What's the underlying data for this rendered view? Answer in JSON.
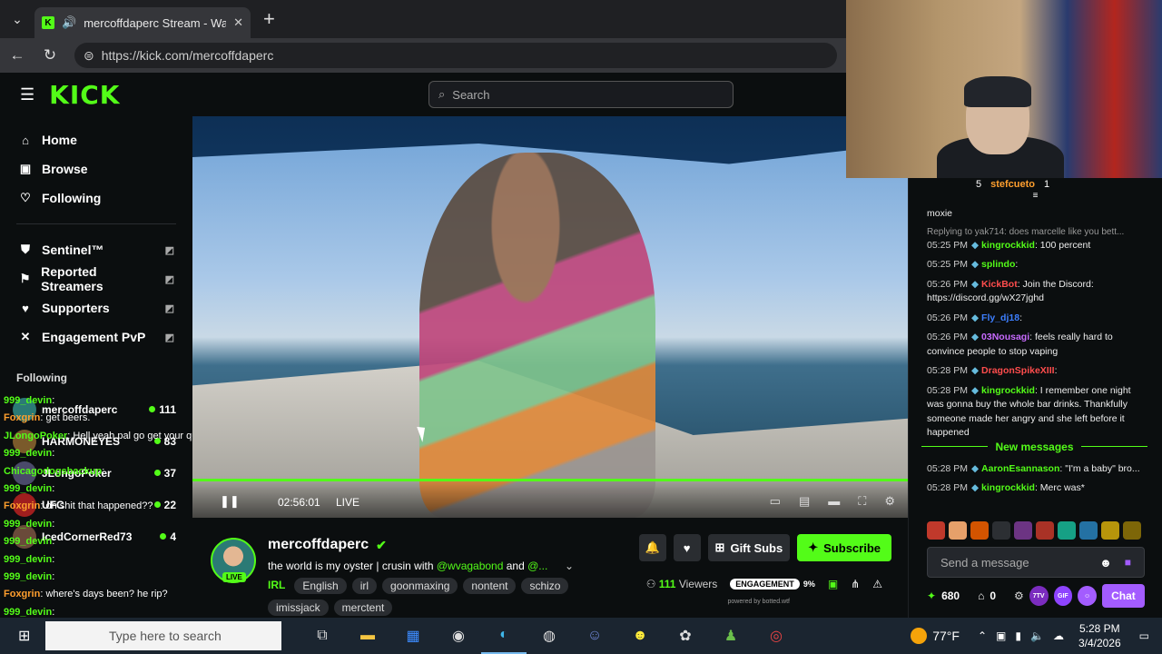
{
  "browser": {
    "tab_title": "mercoffdaperc Stream - Watch",
    "url": "https://kick.com/mercoffdaperc",
    "new_tab": "+",
    "tab_close": "✕"
  },
  "header": {
    "logo": "KICK",
    "search_placeholder": "Search"
  },
  "sidebar": {
    "nav": [
      {
        "label": "Home",
        "icon": "home-icon"
      },
      {
        "label": "Browse",
        "icon": "browse-icon"
      },
      {
        "label": "Following",
        "icon": "heart-icon"
      }
    ],
    "extensions": [
      {
        "label": "Sentinel™"
      },
      {
        "label": "Reported Streamers"
      },
      {
        "label": "Supporters"
      },
      {
        "label": "Engagement PvP"
      }
    ],
    "following_heading": "Following",
    "following": [
      {
        "name": "mercoffdaperc",
        "count": "111"
      },
      {
        "name": "HARMONEYES",
        "count": "83"
      },
      {
        "name": "JLongoPoker",
        "count": "37"
      },
      {
        "name": "UFC",
        "count": "22"
      },
      {
        "name": "IcedCornerRed73",
        "count": "4"
      }
    ]
  },
  "overlay_chat": [
    {
      "user": "999_devin",
      "text": ":"
    },
    {
      "user": "Foxgrin",
      "text": ": get beers."
    },
    {
      "user": "JLongoPoker",
      "text": ": Hell yeah pal go get your queers"
    },
    {
      "user": "999_devin",
      "text": ":"
    },
    {
      "user": "Chicagodogsbackup",
      "text": ":"
    },
    {
      "user": "999_devin",
      "text": ":"
    },
    {
      "user": "Foxgrin",
      "text": ": oh shit that happened??"
    },
    {
      "user": "999_devin",
      "text": ":"
    },
    {
      "user": "999_devin",
      "text": ":"
    },
    {
      "user": "999_devin",
      "text": ":"
    },
    {
      "user": "999_devin",
      "text": ":"
    },
    {
      "user": "Foxgrin",
      "text": ": where's days been? he rip?"
    },
    {
      "user": "999_devin",
      "text": ":"
    }
  ],
  "video": {
    "time": "02:56:01",
    "live_label": "LIVE"
  },
  "stream": {
    "streamer": "mercoffdaperc",
    "live_badge": "LIVE",
    "title_prefix": "the world is my oyster | crusin with ",
    "mention1": "@wvagabond",
    "title_mid": " and ",
    "mention2": "@...",
    "category": "IRL",
    "tags": [
      "English",
      "irl",
      "goonmaxing",
      "nontent",
      "schizo",
      "imissjack",
      "merctent"
    ],
    "gift_label": "Gift Subs",
    "subscribe_label": "Subscribe",
    "viewers": "111",
    "viewers_label": "Viewers",
    "engagement_label": "ENGAGEMENT",
    "engagement_pct": "9%",
    "powered_by": "powered by botted.wtf"
  },
  "chat": {
    "pinned_count": "5",
    "pinned_user": "stefcueto",
    "pinned_num": "1",
    "messages": [
      {
        "time": "",
        "user": "",
        "color": "#fff",
        "text": "moxie"
      },
      {
        "reply": "Replying to yak714: does marcelle like you bett...",
        "time": "05:25 PM",
        "user": "kingrockkid",
        "color": "#53fc18",
        "text": ": 100 percent"
      },
      {
        "time": "05:25 PM",
        "user": "splindo",
        "color": "#53fc18",
        "text": ":"
      },
      {
        "time": "05:26 PM",
        "user": "KickBot",
        "color": "#ff4d4d",
        "text": ": Join the Discord: https://discord.gg/wX27jghd"
      },
      {
        "time": "05:26 PM",
        "user": "Fly_dj18",
        "color": "#3d7fff",
        "text": ":"
      },
      {
        "time": "05:26 PM",
        "user": "03Nousagi",
        "color": "#c86bff",
        "text": ": feels really hard to convince people to stop vaping"
      },
      {
        "time": "05:28 PM",
        "user": "DragonSpikeXIII",
        "color": "#ff4d4d",
        "text": ":"
      },
      {
        "time": "05:28 PM",
        "user": "kingrockkid",
        "color": "#53fc18",
        "text": ": I remember one night was gonna buy the whole bar drinks. Thankfully someone made her angry and she left before it happened"
      }
    ],
    "new_messages": "New messages",
    "messages_after": [
      {
        "time": "05:28 PM",
        "user": "AaronEsannason",
        "color": "#53fc18",
        "text": ": \"I'm a baby\" bro..."
      },
      {
        "time": "05:28 PM",
        "user": "kingrockkid",
        "color": "#53fc18",
        "text": ": Merc was*"
      }
    ],
    "send_placeholder": "Send a message",
    "points": "680",
    "bits": "0",
    "ext1": "7TV",
    "ext2": "GIF",
    "chat_button": "Chat"
  },
  "taskbar": {
    "search_placeholder": "Type here to search",
    "temperature": "77°F",
    "time": "5:28 PM",
    "date": "3/4/2026"
  }
}
